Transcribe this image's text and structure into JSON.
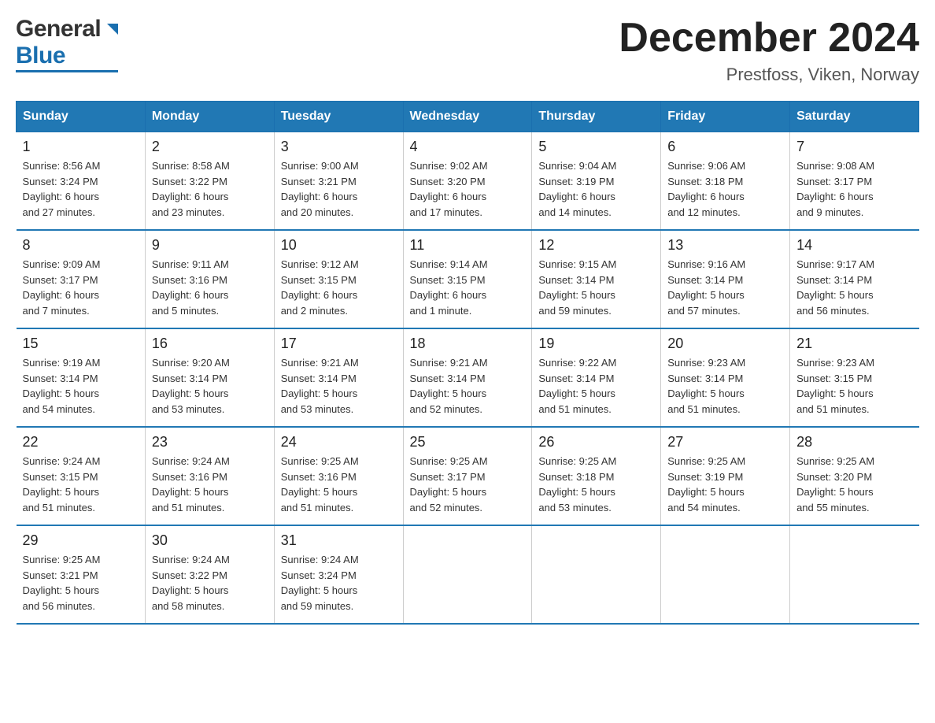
{
  "header": {
    "logo_general": "General",
    "logo_blue": "Blue",
    "title": "December 2024",
    "subtitle": "Prestfoss, Viken, Norway"
  },
  "calendar": {
    "days_of_week": [
      "Sunday",
      "Monday",
      "Tuesday",
      "Wednesday",
      "Thursday",
      "Friday",
      "Saturday"
    ],
    "weeks": [
      [
        {
          "date": "1",
          "info": "Sunrise: 8:56 AM\nSunset: 3:24 PM\nDaylight: 6 hours\nand 27 minutes."
        },
        {
          "date": "2",
          "info": "Sunrise: 8:58 AM\nSunset: 3:22 PM\nDaylight: 6 hours\nand 23 minutes."
        },
        {
          "date": "3",
          "info": "Sunrise: 9:00 AM\nSunset: 3:21 PM\nDaylight: 6 hours\nand 20 minutes."
        },
        {
          "date": "4",
          "info": "Sunrise: 9:02 AM\nSunset: 3:20 PM\nDaylight: 6 hours\nand 17 minutes."
        },
        {
          "date": "5",
          "info": "Sunrise: 9:04 AM\nSunset: 3:19 PM\nDaylight: 6 hours\nand 14 minutes."
        },
        {
          "date": "6",
          "info": "Sunrise: 9:06 AM\nSunset: 3:18 PM\nDaylight: 6 hours\nand 12 minutes."
        },
        {
          "date": "7",
          "info": "Sunrise: 9:08 AM\nSunset: 3:17 PM\nDaylight: 6 hours\nand 9 minutes."
        }
      ],
      [
        {
          "date": "8",
          "info": "Sunrise: 9:09 AM\nSunset: 3:17 PM\nDaylight: 6 hours\nand 7 minutes."
        },
        {
          "date": "9",
          "info": "Sunrise: 9:11 AM\nSunset: 3:16 PM\nDaylight: 6 hours\nand 5 minutes."
        },
        {
          "date": "10",
          "info": "Sunrise: 9:12 AM\nSunset: 3:15 PM\nDaylight: 6 hours\nand 2 minutes."
        },
        {
          "date": "11",
          "info": "Sunrise: 9:14 AM\nSunset: 3:15 PM\nDaylight: 6 hours\nand 1 minute."
        },
        {
          "date": "12",
          "info": "Sunrise: 9:15 AM\nSunset: 3:14 PM\nDaylight: 5 hours\nand 59 minutes."
        },
        {
          "date": "13",
          "info": "Sunrise: 9:16 AM\nSunset: 3:14 PM\nDaylight: 5 hours\nand 57 minutes."
        },
        {
          "date": "14",
          "info": "Sunrise: 9:17 AM\nSunset: 3:14 PM\nDaylight: 5 hours\nand 56 minutes."
        }
      ],
      [
        {
          "date": "15",
          "info": "Sunrise: 9:19 AM\nSunset: 3:14 PM\nDaylight: 5 hours\nand 54 minutes."
        },
        {
          "date": "16",
          "info": "Sunrise: 9:20 AM\nSunset: 3:14 PM\nDaylight: 5 hours\nand 53 minutes."
        },
        {
          "date": "17",
          "info": "Sunrise: 9:21 AM\nSunset: 3:14 PM\nDaylight: 5 hours\nand 53 minutes."
        },
        {
          "date": "18",
          "info": "Sunrise: 9:21 AM\nSunset: 3:14 PM\nDaylight: 5 hours\nand 52 minutes."
        },
        {
          "date": "19",
          "info": "Sunrise: 9:22 AM\nSunset: 3:14 PM\nDaylight: 5 hours\nand 51 minutes."
        },
        {
          "date": "20",
          "info": "Sunrise: 9:23 AM\nSunset: 3:14 PM\nDaylight: 5 hours\nand 51 minutes."
        },
        {
          "date": "21",
          "info": "Sunrise: 9:23 AM\nSunset: 3:15 PM\nDaylight: 5 hours\nand 51 minutes."
        }
      ],
      [
        {
          "date": "22",
          "info": "Sunrise: 9:24 AM\nSunset: 3:15 PM\nDaylight: 5 hours\nand 51 minutes."
        },
        {
          "date": "23",
          "info": "Sunrise: 9:24 AM\nSunset: 3:16 PM\nDaylight: 5 hours\nand 51 minutes."
        },
        {
          "date": "24",
          "info": "Sunrise: 9:25 AM\nSunset: 3:16 PM\nDaylight: 5 hours\nand 51 minutes."
        },
        {
          "date": "25",
          "info": "Sunrise: 9:25 AM\nSunset: 3:17 PM\nDaylight: 5 hours\nand 52 minutes."
        },
        {
          "date": "26",
          "info": "Sunrise: 9:25 AM\nSunset: 3:18 PM\nDaylight: 5 hours\nand 53 minutes."
        },
        {
          "date": "27",
          "info": "Sunrise: 9:25 AM\nSunset: 3:19 PM\nDaylight: 5 hours\nand 54 minutes."
        },
        {
          "date": "28",
          "info": "Sunrise: 9:25 AM\nSunset: 3:20 PM\nDaylight: 5 hours\nand 55 minutes."
        }
      ],
      [
        {
          "date": "29",
          "info": "Sunrise: 9:25 AM\nSunset: 3:21 PM\nDaylight: 5 hours\nand 56 minutes."
        },
        {
          "date": "30",
          "info": "Sunrise: 9:24 AM\nSunset: 3:22 PM\nDaylight: 5 hours\nand 58 minutes."
        },
        {
          "date": "31",
          "info": "Sunrise: 9:24 AM\nSunset: 3:24 PM\nDaylight: 5 hours\nand 59 minutes."
        },
        {
          "date": "",
          "info": ""
        },
        {
          "date": "",
          "info": ""
        },
        {
          "date": "",
          "info": ""
        },
        {
          "date": "",
          "info": ""
        }
      ]
    ]
  }
}
